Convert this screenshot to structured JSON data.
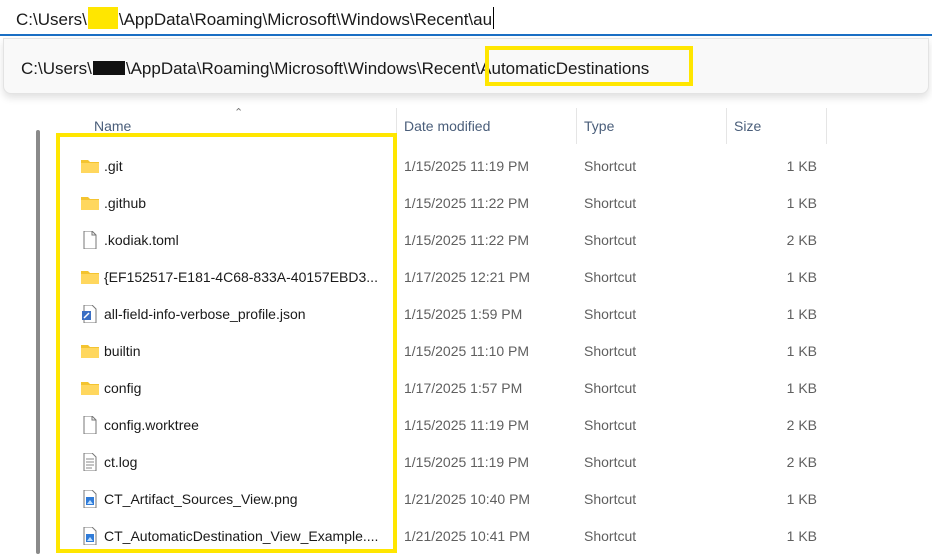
{
  "address_bar": {
    "prefix": "C:\\Users\\",
    "suffix": "\\AppData\\Roaming\\Microsoft\\Windows\\Recent\\au"
  },
  "suggestion": {
    "prefix": "C:\\Users\\",
    "middle": "\\AppData\\Roaming\\Microsoft\\Windows\\Recent",
    "highlight": "\\AutomaticDestinations"
  },
  "columns": {
    "name": "Name",
    "date": "Date modified",
    "type": "Type",
    "size": "Size"
  },
  "files": [
    {
      "name": ".git",
      "icon": "folder-icon",
      "date": "1/15/2025 11:19 PM",
      "type": "Shortcut",
      "size": "1 KB"
    },
    {
      "name": ".github",
      "icon": "folder-icon",
      "date": "1/15/2025 11:22 PM",
      "type": "Shortcut",
      "size": "1 KB"
    },
    {
      "name": ".kodiak.toml",
      "icon": "file-icon",
      "date": "1/15/2025 11:22 PM",
      "type": "Shortcut",
      "size": "2 KB"
    },
    {
      "name": "{EF152517-E181-4C68-833A-40157EBD3...",
      "icon": "folder-icon",
      "date": "1/17/2025 12:21 PM",
      "type": "Shortcut",
      "size": "1 KB"
    },
    {
      "name": "all-field-info-verbose_profile.json",
      "icon": "json-file-icon",
      "date": "1/15/2025 1:59 PM",
      "type": "Shortcut",
      "size": "1 KB"
    },
    {
      "name": "builtin",
      "icon": "folder-icon",
      "date": "1/15/2025 11:10 PM",
      "type": "Shortcut",
      "size": "1 KB"
    },
    {
      "name": "config",
      "icon": "folder-icon",
      "date": "1/17/2025 1:57 PM",
      "type": "Shortcut",
      "size": "1 KB"
    },
    {
      "name": "config.worktree",
      "icon": "file-icon",
      "date": "1/15/2025 11:19 PM",
      "type": "Shortcut",
      "size": "2 KB"
    },
    {
      "name": "ct.log",
      "icon": "text-file-icon",
      "date": "1/15/2025 11:19 PM",
      "type": "Shortcut",
      "size": "2 KB"
    },
    {
      "name": "CT_Artifact_Sources_View.png",
      "icon": "image-file-icon",
      "date": "1/21/2025 10:40 PM",
      "type": "Shortcut",
      "size": "1 KB"
    },
    {
      "name": "CT_AutomaticDestination_View_Example....",
      "icon": "image-file-icon",
      "date": "1/21/2025 10:41 PM",
      "type": "Shortcut",
      "size": "1 KB"
    }
  ],
  "colors": {
    "highlight": "#ffe600",
    "folder": "#f4c430",
    "accent": "#1a6fc4"
  }
}
